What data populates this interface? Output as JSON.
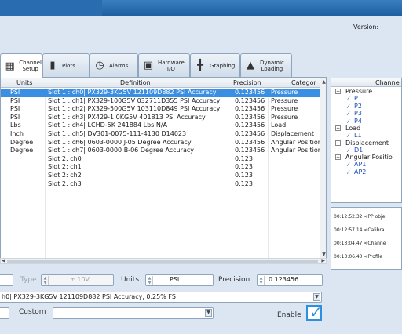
{
  "header": {
    "version_label": "Version:"
  },
  "tabs": [
    {
      "label": "Channel\nSetup",
      "icon": "channel-setup-icon",
      "active": true
    },
    {
      "label": "Plots",
      "icon": "plots-icon"
    },
    {
      "label": "Alarms",
      "icon": "alarm-clock-icon"
    },
    {
      "label": "Hardware\nI/O",
      "icon": "hardware-icon"
    },
    {
      "label": "Graphing",
      "icon": "graphing-icon"
    },
    {
      "label": "Dynamic\nLoading",
      "icon": "dynamic-loading-icon"
    }
  ],
  "table": {
    "columns": [
      "Units",
      "Definition",
      "Precision",
      "Categor"
    ],
    "rows": [
      {
        "units": "PSI",
        "definition": "Slot 1 : ch0| PX329-3KG5V 121109D882 PSI Accuracy",
        "precision": "0.123456",
        "category": "Pressure",
        "selected": true
      },
      {
        "units": "PSI",
        "definition": "Slot 1 : ch1| PX329-100G5V 032711D355 PSI Accuracy",
        "precision": "0.123456",
        "category": "Pressure"
      },
      {
        "units": "PSI",
        "definition": "Slot 1 : ch2| PX329-500G5V 103110D849 PSI Accuracy",
        "precision": "0.123456",
        "category": "Pressure"
      },
      {
        "units": "PSI",
        "definition": "Slot 1 : ch3| PX429-1.0KG5V 401813 PSI Accuracy",
        "precision": "0.123456",
        "category": "Pressure"
      },
      {
        "units": "Lbs",
        "definition": "Slot 1 : ch4| LCHD-5K 241884 Lbs N/A",
        "precision": "0.123456",
        "category": "Load"
      },
      {
        "units": "Inch",
        "definition": "Slot 1 : ch5| DV301-0075-111-4130 D14023",
        "precision": "0.123456",
        "category": "Displacement"
      },
      {
        "units": "Degree",
        "definition": "Slot 1 : ch6| 0603-0000 J-05 Degree Accuracy",
        "precision": "0.123456",
        "category": "Angular Position"
      },
      {
        "units": "Degree",
        "definition": "Slot 1 : ch7| 0603-0000 B-06 Degree Accuracy",
        "precision": "0.123456",
        "category": "Angular Position"
      },
      {
        "units": "",
        "definition": "Slot 2: ch0",
        "precision": "0.123",
        "category": ""
      },
      {
        "units": "",
        "definition": "Slot 2: ch1",
        "precision": "0.123",
        "category": ""
      },
      {
        "units": "",
        "definition": "Slot 2: ch2",
        "precision": "0.123",
        "category": ""
      },
      {
        "units": "",
        "definition": "Slot 2: ch3",
        "precision": "0.123",
        "category": ""
      }
    ]
  },
  "channels_panel": {
    "title": "Channe",
    "groups": [
      {
        "label": "Pressure",
        "items": [
          "P1",
          "P2",
          "P3",
          "P4"
        ]
      },
      {
        "label": "Load",
        "items": [
          "L1"
        ]
      },
      {
        "label": "Displacement",
        "items": [
          "D1"
        ]
      },
      {
        "label": "Angular Positio",
        "items": [
          "AP1",
          "AP2"
        ]
      }
    ]
  },
  "log": [
    "00:12:52.32 <PP obje",
    "00:12:57.14 <Calibra",
    "00:13:04.47 <Channe",
    "00:13:06.40 <Profile"
  ],
  "form": {
    "type_label": "Type",
    "type_value": "± 10V",
    "units_label": "Units",
    "units_value": "PSI",
    "precision_label": "Precision",
    "precision_value": "0.123456",
    "definition_value": "h0| PX329-3KG5V 121109D882 PSI Accuracy, 0.25% FS",
    "custom_label": "Custom",
    "custom_value": "",
    "enable_label": "Enable",
    "enable_checked": true
  },
  "colors": {
    "selection": "#3b8fe3",
    "accent": "#2d8fe0",
    "background": "#dbe6f2"
  }
}
